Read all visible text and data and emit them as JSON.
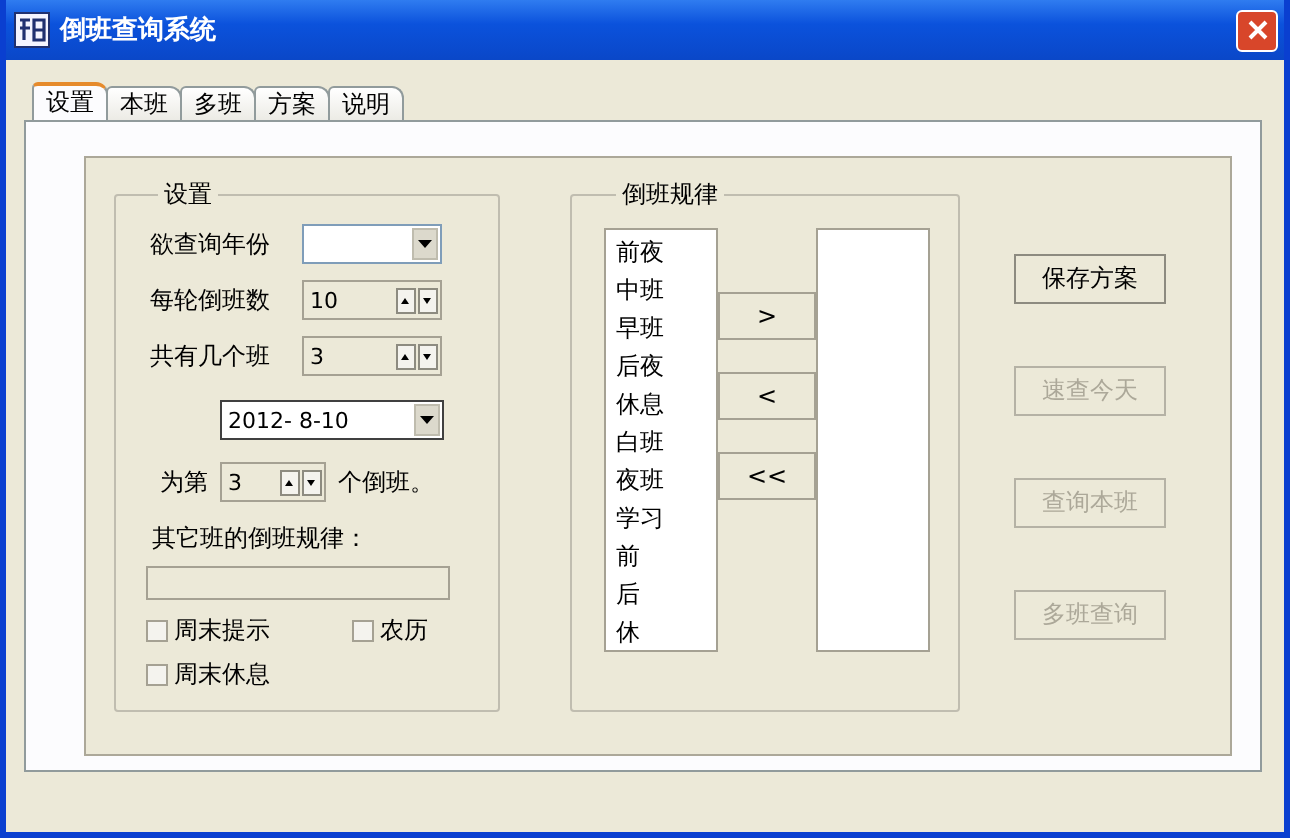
{
  "window": {
    "title": "倒班查询系统"
  },
  "tabs": [
    {
      "label": "设置",
      "selected": true
    },
    {
      "label": "本班",
      "selected": false
    },
    {
      "label": "多班",
      "selected": false
    },
    {
      "label": "方案",
      "selected": false
    },
    {
      "label": "说明",
      "selected": false
    }
  ],
  "settings": {
    "title": "设置",
    "year": {
      "label": "欲查询年份"
    },
    "shifts_per_cycle": {
      "label": "每轮倒班数",
      "value": "10"
    },
    "team_count": {
      "label": "共有几个班",
      "value": "3"
    },
    "date": {
      "value": "2012- 8-10"
    },
    "position": {
      "prefix": "为第",
      "value": "3",
      "suffix": "个倒班。"
    },
    "other_pattern": {
      "label": "其它班的倒班规律："
    },
    "checkboxes": [
      {
        "label": "周末提示",
        "checked": false
      },
      {
        "label": "农历",
        "checked": false
      },
      {
        "label": "周末休息",
        "checked": false
      }
    ]
  },
  "pattern": {
    "title": "倒班规律",
    "available": [
      "前夜",
      "中班",
      "早班",
      "后夜",
      "休息",
      "白班",
      "夜班",
      "学习",
      "前",
      "后",
      "休"
    ],
    "move_buttons": [
      ">",
      "<",
      "<<"
    ]
  },
  "actions": [
    {
      "label": "保存方案",
      "disabled": false
    },
    {
      "label": "速查今天",
      "disabled": true
    },
    {
      "label": "查询本班",
      "disabled": true
    },
    {
      "label": "多班查询",
      "disabled": true
    }
  ]
}
